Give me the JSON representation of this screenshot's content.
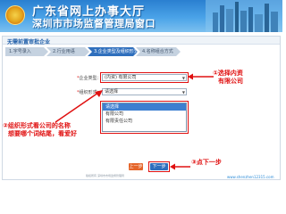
{
  "header": {
    "title_line1": "广东省网上办事大厅",
    "title_line2": "深圳市市场监督管理局窗口"
  },
  "section": {
    "title": "无需前置审批企业"
  },
  "steps": [
    {
      "label": "1.字号录入"
    },
    {
      "label": "2.行业用语"
    },
    {
      "label": "3.企业类型及组织形式"
    },
    {
      "label": "4.名称组合方式"
    }
  ],
  "form": {
    "company_type_label": "企业类型",
    "company_type_value": "(内资) 有限公司",
    "org_form_label": "组织形式",
    "org_form_value": "请选择"
  },
  "dropdown_options": [
    "请选择",
    "有限公司",
    "有限责任公司"
  ],
  "buttons": {
    "prev": "上一步",
    "next": "下一步"
  },
  "annotations": {
    "note1_line1": "①选择内资",
    "note1_line2": "有限公司",
    "note2_line1": "②组织形式看公司的名称",
    "note2_line2": "想要哪个词结尾，看爱好",
    "note3": "③点下一步"
  },
  "footer_text": "版权所有 深圳市市场监督管理局",
  "watermark": "www.shenzhen12315.com",
  "colors": {
    "annotation": "#e01010",
    "primary": "#2f6fbd",
    "step_active": "#2f6fbd"
  }
}
